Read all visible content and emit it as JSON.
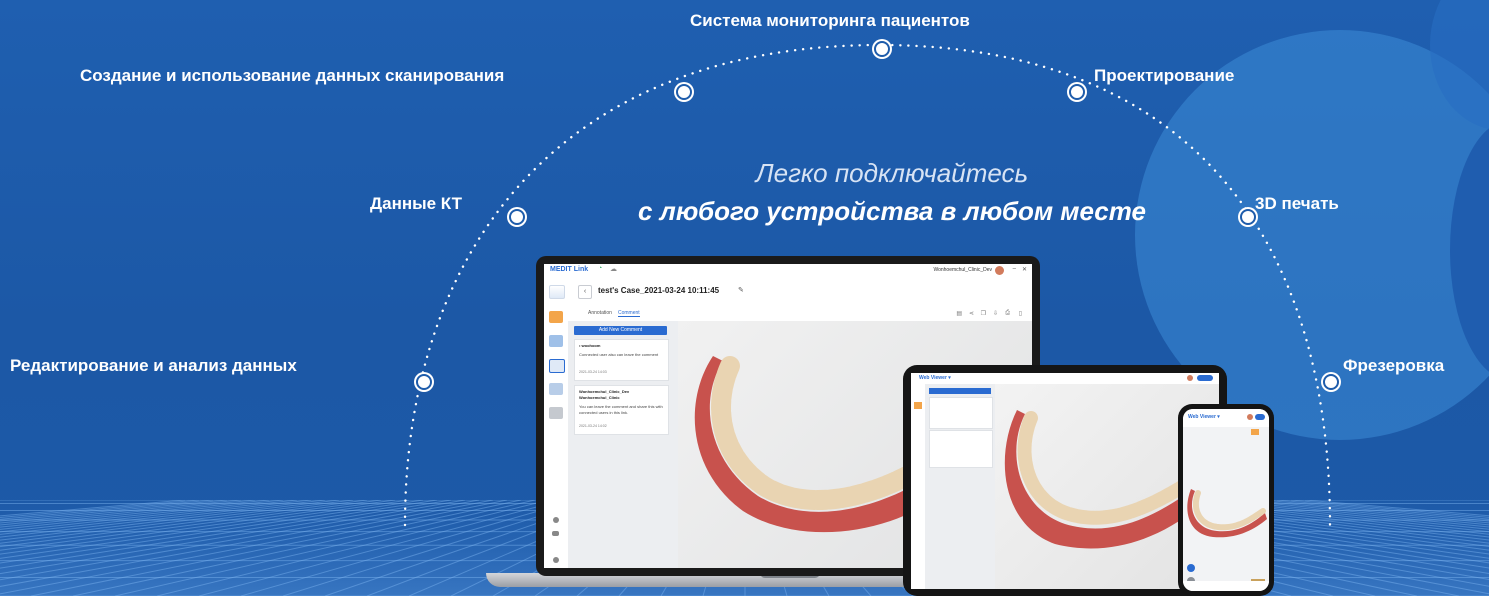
{
  "banner": {
    "headline_line1": "Легко подключайтесь",
    "headline_line2": "с любого устройства в любом месте",
    "features": [
      {
        "label": "Система мониторинга пациентов"
      },
      {
        "label": "Создание и использование данных сканирования"
      },
      {
        "label": "Проектирование"
      },
      {
        "label": "Данные КТ"
      },
      {
        "label": "3D печать"
      },
      {
        "label": "Редактирование и анализ данных"
      },
      {
        "label": "Фрезеровка"
      }
    ]
  },
  "laptop_app": {
    "logo": "MEDIT Link",
    "user": "Wonhoemchul_Clinic_Dev",
    "case_title": "test's Case_2021-03-24 10:11:45",
    "tabs": [
      {
        "label": "Annotation"
      },
      {
        "label": "Comment"
      }
    ],
    "add_comment_label": "Add New Comment",
    "comments": [
      {
        "author": "• woohoom",
        "text": "Connected user also can leave the comment",
        "date": "2021-03-24 14:03"
      },
      {
        "author": "Wonhoemchul_Clinic_Dev Wonhoemchul_Clinic",
        "text": "You can leave the comment and share this with connected users in this link.",
        "date": "2021-03-24 14:02"
      }
    ]
  },
  "tablet_app": {
    "title": "Web Viewer ▾"
  },
  "phone_app": {
    "title": "Web Viewer ▾"
  },
  "colors": {
    "background": "#1e5cab",
    "accent": "#2a6bd1",
    "gum": "#c8524d",
    "tooth": "#e9d4b2"
  }
}
